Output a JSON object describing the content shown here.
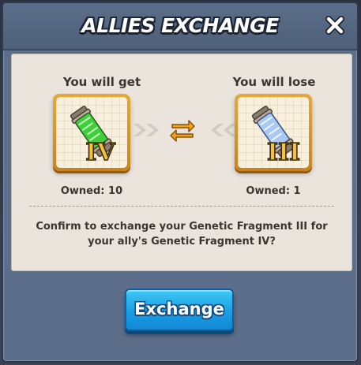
{
  "dialog": {
    "title": "ALLIES EXCHANGE",
    "close_icon": "close-icon"
  },
  "get": {
    "label": "You will get",
    "item_icon": "genetic-fragment-iv-icon",
    "item_numeral": "IV",
    "owned": "Owned: 10"
  },
  "lose": {
    "label": "You will lose",
    "item_icon": "genetic-fragment-iii-icon",
    "item_numeral": "III",
    "owned": "Owned: 1"
  },
  "swap_icon": "swap-arrows-icon",
  "confirm": {
    "line1": "Confirm to exchange your Genetic Fragment III for",
    "line2": "your ally's Genetic Fragment IV?"
  },
  "exchange_button": {
    "label": "Exchange"
  },
  "colors": {
    "accent_blue": "#1a9ee6",
    "card_gold": "#e4a93a",
    "panel_bg": "#ebe4dc",
    "header_bg": "#5c6e8a",
    "swap_orange": "#f2a216",
    "green_liquid": "#3fcf3a",
    "blue_liquid": "#8fb8f0"
  }
}
